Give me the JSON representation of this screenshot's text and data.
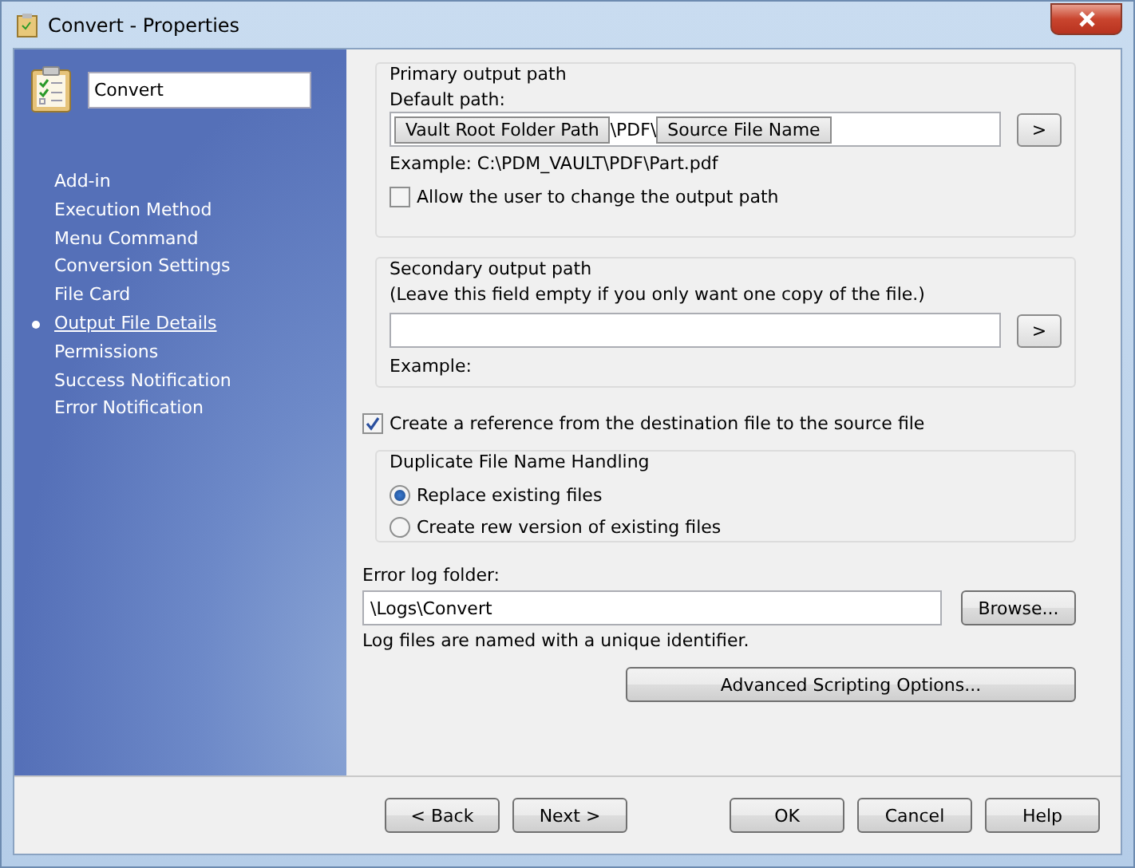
{
  "window": {
    "title": "Convert - Properties"
  },
  "sidebar": {
    "name_value": "Convert",
    "items": [
      {
        "label": "Add-in",
        "selected": false
      },
      {
        "label": "Execution Method",
        "selected": false
      },
      {
        "label": "Menu Command",
        "selected": false
      },
      {
        "label": "Conversion Settings",
        "selected": false
      },
      {
        "label": "File Card",
        "selected": false
      },
      {
        "label": "Output File Details",
        "selected": true
      },
      {
        "label": "Permissions",
        "selected": false
      },
      {
        "label": "Success Notification",
        "selected": false
      },
      {
        "label": "Error Notification",
        "selected": false
      }
    ]
  },
  "primary": {
    "title": "Primary output path",
    "field_label": "Default path:",
    "tokens": [
      {
        "kind": "token",
        "text": "Vault Root Folder Path"
      },
      {
        "kind": "literal",
        "text": "\\PDF\\"
      },
      {
        "kind": "token",
        "text": "Source File Name"
      }
    ],
    "insert_button": ">",
    "example": "Example: C:\\PDM_VAULT\\PDF\\Part.pdf",
    "allow_change": {
      "label": "Allow the user to change the output path",
      "checked": false
    }
  },
  "secondary": {
    "title": "Secondary output path",
    "hint": "(Leave this field empty if you only want one copy of the file.)",
    "insert_button": ">",
    "example": "Example:"
  },
  "create_reference": {
    "label": "Create a reference from the destination file to the source file",
    "checked": true
  },
  "duplicate": {
    "title": "Duplicate File Name Handling",
    "options": [
      {
        "label": "Replace existing files",
        "selected": true
      },
      {
        "label": "Create rew version of existing files",
        "selected": false
      }
    ]
  },
  "error_log": {
    "label": "Error log folder:",
    "value": "\\Logs\\Convert",
    "browse": "Browse...",
    "note": "Log files are named with a unique identifier."
  },
  "advanced_button": "Advanced Scripting Options...",
  "buttons": {
    "left": [
      "< Back",
      "Next >"
    ],
    "right": [
      "OK",
      "Cancel",
      "Help"
    ]
  }
}
